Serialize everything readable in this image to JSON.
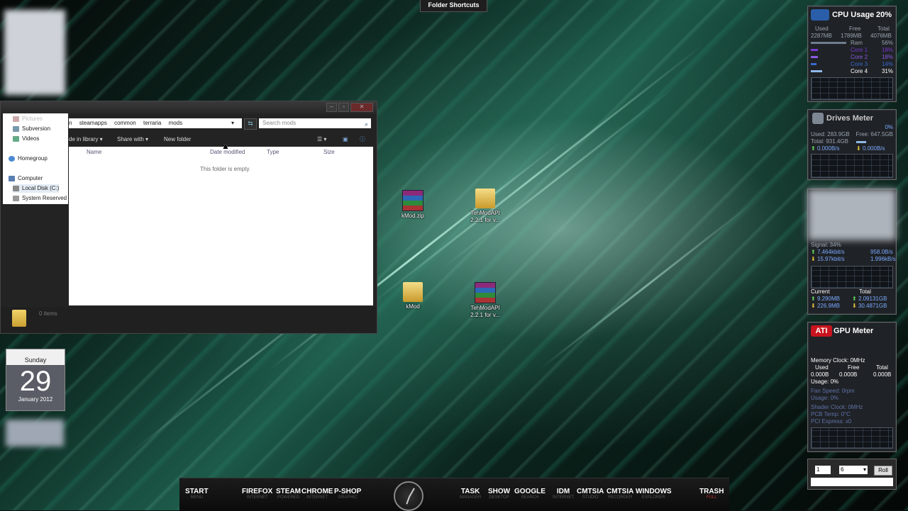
{
  "top_tab": "Folder Shortcuts",
  "explorer": {
    "breadcrumb": [
      "n",
      "steamapps",
      "common",
      "terraria",
      "mods"
    ],
    "search_placeholder": "Search mods",
    "toolbar": {
      "include_library": "de in library",
      "share_with": "Share with",
      "new_folder": "New folder"
    },
    "columns": [
      "Name",
      "Date modified",
      "Type",
      "Size"
    ],
    "empty_message": "This folder is empty.",
    "nav": [
      {
        "label": "Pictures"
      },
      {
        "label": "Subversion"
      },
      {
        "label": "Videos"
      },
      {
        "label": "Homegroup"
      },
      {
        "label": "Computer"
      },
      {
        "label": "Local Disk (C:)"
      },
      {
        "label": "System Reserved"
      }
    ],
    "status_count": "0 items"
  },
  "desktop_icons": [
    {
      "label": "kMod.zip",
      "kind": "rar"
    },
    {
      "label": "TehModAPI 2.2.1 for v...",
      "kind": "folder"
    },
    {
      "label": "kMod",
      "kind": "folder"
    },
    {
      "label": "TehModAPI 2.2.1 for v...",
      "kind": "rar"
    }
  ],
  "calendar": {
    "weekday": "Sunday",
    "day": "29",
    "month_year": "January 2012"
  },
  "cpu": {
    "title": "CPU Usage",
    "percent": "20%",
    "headers": [
      "Used",
      "Free",
      "Total"
    ],
    "values": [
      "2287MB",
      "1789MB",
      "4076MB"
    ],
    "ram_label": "Ram",
    "ram_pct": "56%",
    "cores": [
      {
        "label": "Core 1",
        "pct": "18%"
      },
      {
        "label": "Core 2",
        "pct": "18%"
      },
      {
        "label": "Core 3",
        "pct": "14%"
      },
      {
        "label": "Core 4",
        "pct": "31%"
      }
    ]
  },
  "drives": {
    "title": "Drives Meter",
    "pct": "0%",
    "used": "Used: 283.9GB",
    "free": "Free: 647.5GB",
    "total": "Total: 931.4GB",
    "up": "0.000B/s",
    "down": "0.000B/s"
  },
  "network": {
    "signal": "Signal: 34%",
    "row1": [
      "7.464kbit/s",
      "958.0B/s"
    ],
    "row2": [
      "15.97kbit/s",
      "1.996kB/s"
    ],
    "current_label": "Current",
    "total_label": "Total",
    "cur_up": "9.290MB",
    "tot_up": "2.09131GB",
    "cur_down": "226.9MB",
    "tot_down": "30.4871GB"
  },
  "gpu": {
    "brand": "ATI",
    "title": "GPU Meter",
    "memory_clock": "Memory Clock: 0MHz",
    "headers": [
      "Used",
      "Free",
      "Total"
    ],
    "values": [
      "0.000B",
      "0.000B",
      "0.000B"
    ],
    "usage": "Usage: 0%",
    "fan": "Fan Speed: 0rpm",
    "fan_usage": "Usage: 0%",
    "shader": "Shader Clock: 0MHz",
    "pcb": "PCB Temp: 0°C",
    "pci": "PCI Express: x0"
  },
  "dice": {
    "count": "1",
    "sides": "6",
    "roll": "Roll"
  },
  "dock": [
    {
      "label": "START",
      "sub": "MENU"
    },
    {
      "label": "FIREFOX",
      "sub": "INTERNET"
    },
    {
      "label": "STEAM",
      "sub": "POWERED"
    },
    {
      "label": "CHROME",
      "sub": "INTERNET"
    },
    {
      "label": "P-SHOP",
      "sub": "GRAPHIC"
    },
    {
      "label": "TASK",
      "sub": "MANAGER"
    },
    {
      "label": "SHOW",
      "sub": "DESKTOP"
    },
    {
      "label": "GOOGLE",
      "sub": "SEARCH"
    },
    {
      "label": "IDM",
      "sub": "INTERNET"
    },
    {
      "label": "CMTSIA",
      "sub": "STUDIO"
    },
    {
      "label": "CMTSIA",
      "sub": "RECORDER"
    },
    {
      "label": "WINDOWS",
      "sub": "EXPLORER"
    },
    {
      "label": "TRASH",
      "sub": "FULL"
    }
  ]
}
